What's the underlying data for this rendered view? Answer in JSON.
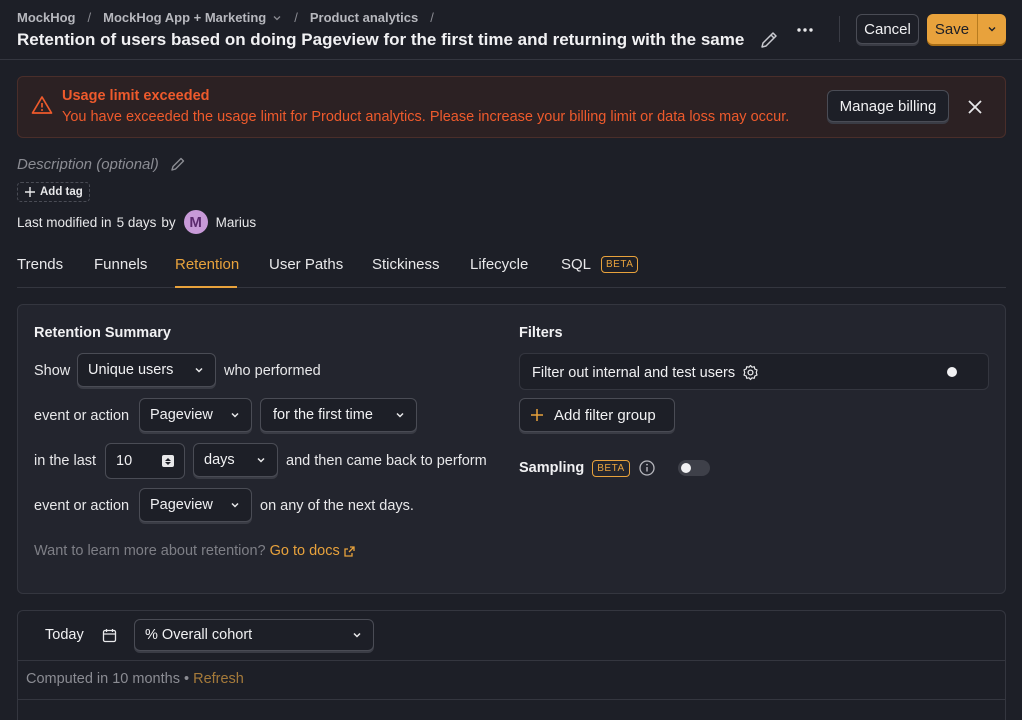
{
  "breadcrumb": {
    "org": "MockHog",
    "project": "MockHog App + Marketing",
    "section": "Product analytics",
    "separator": "/"
  },
  "title": "Retention of users based on doing Pageview for the first time and returning with the same …",
  "header": {
    "cancel_label": "Cancel",
    "save_label": "Save"
  },
  "banner": {
    "title": "Usage limit exceeded",
    "message": "You have exceeded the usage limit for Product analytics. Please increase your billing limit or data loss may occur.",
    "button_label": "Manage billing",
    "color": "#ee5a2c"
  },
  "description": {
    "placeholder": "Description (optional)"
  },
  "add_tag_label": "Add tag",
  "last_modified": {
    "prefix": "Last modified in",
    "time": "5 days",
    "by": "by",
    "avatar_letter": "M",
    "user": "Marius"
  },
  "tabs": [
    {
      "label": "Trends"
    },
    {
      "label": "Funnels"
    },
    {
      "label": "Retention",
      "active": true
    },
    {
      "label": "User Paths"
    },
    {
      "label": "Stickiness"
    },
    {
      "label": "Lifecycle"
    },
    {
      "label": "SQL",
      "badge": "BETA"
    }
  ],
  "retention": {
    "heading": "Retention Summary",
    "show_label": "Show",
    "aggregation": "Unique users",
    "who_performed": "who performed",
    "event_label": "event or action",
    "target_event": "Pageview",
    "period_type": "for the first time",
    "in_the_last": "in the last",
    "total_intervals": "10",
    "interval_unit": "days",
    "came_back": "and then came back to perform",
    "event_label_2": "event or action",
    "returning_event": "Pageview",
    "next_days": "on any of the next days.",
    "learn_more": "Want to learn more about retention?",
    "docs_link": "Go to docs"
  },
  "filters": {
    "heading": "Filters",
    "internal_label": "Filter out internal and test users",
    "internal_enabled": false,
    "add_filter_group": "Add filter group",
    "sampling_label": "Sampling",
    "sampling_badge": "BETA",
    "sampling_enabled": false
  },
  "results": {
    "date_label": "Today",
    "display_mode": "% Overall cohort",
    "computed_text": "Computed in 10 months",
    "bullet": "•",
    "refresh_label": "Refresh"
  },
  "colors": {
    "accent": "#e8a23c",
    "background": "#1d1f27",
    "warning": "#ee5a2c"
  }
}
